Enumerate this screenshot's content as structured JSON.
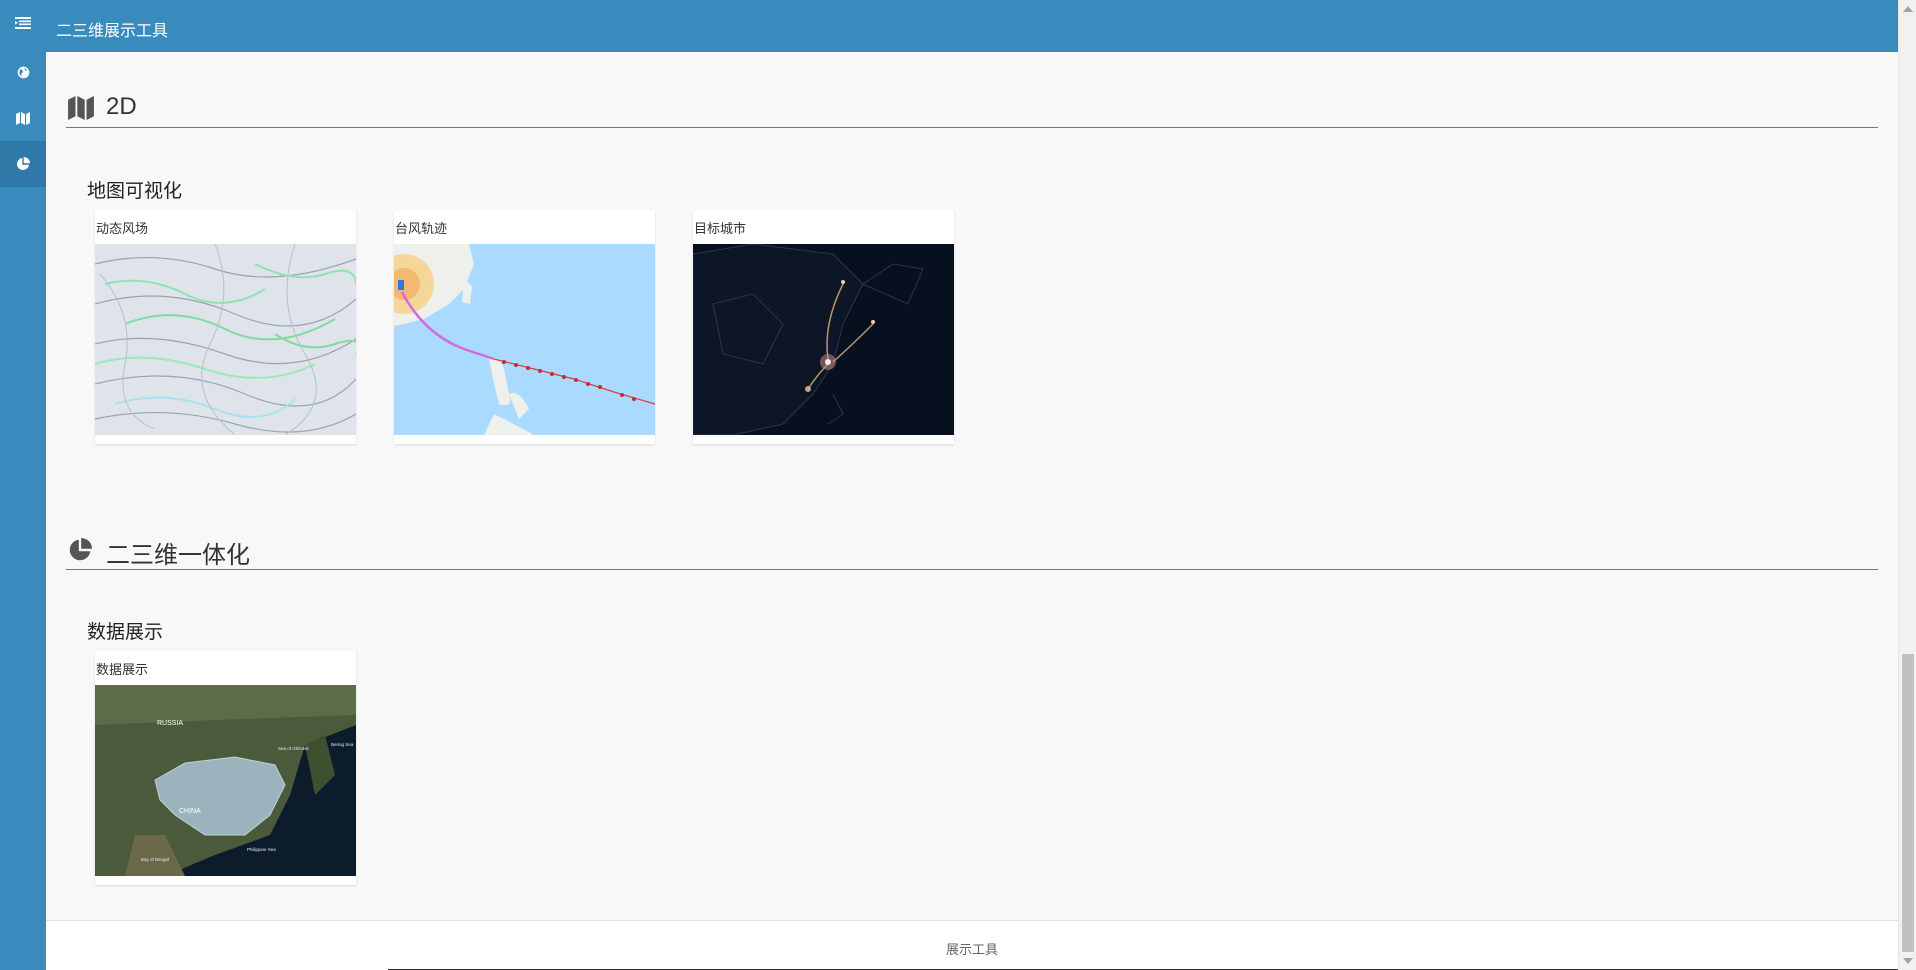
{
  "app": {
    "title": "二三维展示工具"
  },
  "sidebar": {
    "items": [
      {
        "icon": "menu-icon"
      },
      {
        "icon": "globe-icon"
      },
      {
        "icon": "map-icon"
      },
      {
        "icon": "pie-chart-icon",
        "active": true
      }
    ]
  },
  "sections": [
    {
      "title": "2D",
      "icon": "map-icon",
      "groups": [
        {
          "title": "地图可视化",
          "cards": [
            {
              "label": "动态风场"
            },
            {
              "label": "台风轨迹"
            },
            {
              "label": "目标城市"
            }
          ]
        }
      ]
    },
    {
      "title": "二三维一体化",
      "icon": "pie-chart-icon",
      "groups": [
        {
          "title": "数据展示",
          "cards": [
            {
              "label": "数据展示"
            }
          ]
        }
      ]
    }
  ],
  "thumbnail_text": {
    "russia": "RUSSIA",
    "china": "CHINA",
    "sea_of_okhotsk": "Sea of Okhotsk",
    "bering_sea": "Bering Sea",
    "philippine_sea": "Philippine Sea",
    "bay_of_bengal": "Bay of Bengal"
  },
  "footer": {
    "text": "展示工具"
  },
  "colors": {
    "primary": "#3a8bbd",
    "primary_dark": "#2e79a8",
    "background": "#f8f8f8"
  }
}
